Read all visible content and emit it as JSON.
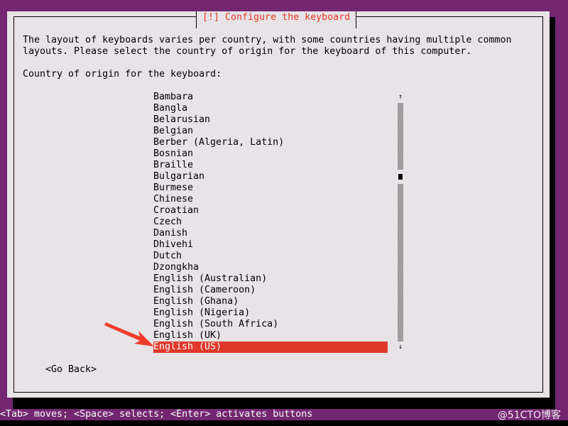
{
  "dialog": {
    "title": "[!] Configure the keyboard",
    "description_lines": [
      "The layout of keyboards varies per country, with some countries having multiple common",
      "layouts. Please select the country of origin for the keyboard of this computer."
    ],
    "prompt": "Country of origin for the keyboard:",
    "items": [
      "Bambara",
      "Bangla",
      "Belarusian",
      "Belgian",
      "Berber (Algeria, Latin)",
      "Bosnian",
      "Braille",
      "Bulgarian",
      "Burmese",
      "Chinese",
      "Croatian",
      "Czech",
      "Danish",
      "Dhivehi",
      "Dutch",
      "Dzongkha",
      "English (Australian)",
      "English (Cameroon)",
      "English (Ghana)",
      "English (Nigeria)",
      "English (South Africa)",
      "English (UK)",
      "English (US)"
    ],
    "selected": "English (US)",
    "scroll_up": "↑",
    "scroll_down": "↓",
    "go_back": "<Go Back>"
  },
  "status_bar": "<Tab> moves; <Space> selects; <Enter> activates buttons",
  "watermark": "@51CTO博客",
  "colors": {
    "background": "#722770",
    "dialog": "#e8e3e7",
    "accent": "#e0392b",
    "title": "#e33a24"
  }
}
